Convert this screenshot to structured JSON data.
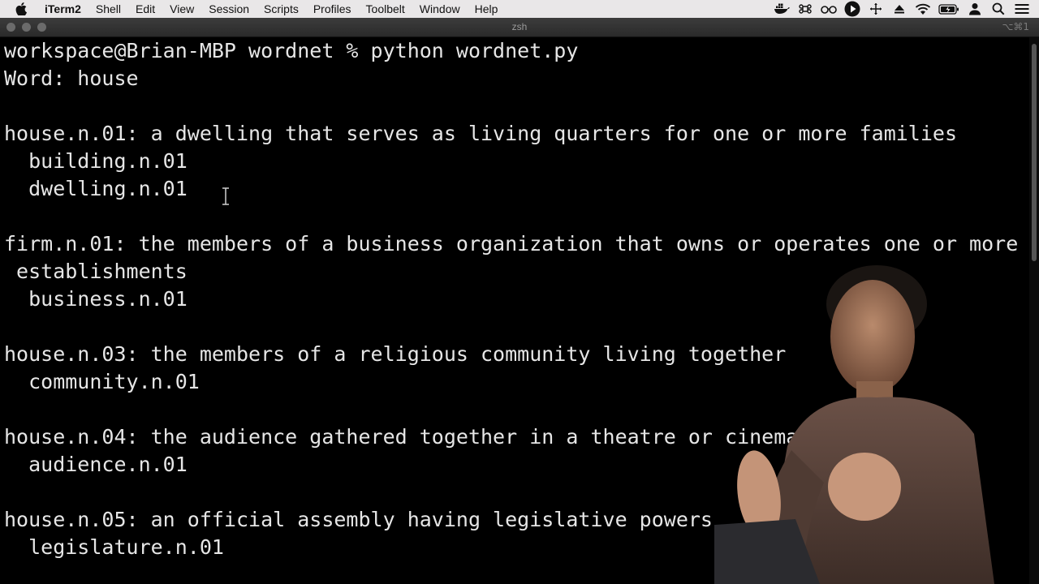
{
  "menubar": {
    "apple_icon": "apple-logo-icon",
    "app_name": "iTerm2",
    "items": [
      "Shell",
      "Edit",
      "View",
      "Session",
      "Scripts",
      "Profiles",
      "Toolbelt",
      "Window",
      "Help"
    ],
    "status_icons": [
      "docker-icon",
      "command-key-icon",
      "glasses-icon",
      "play-circle-icon",
      "move-icon",
      "eject-icon",
      "wifi-icon",
      "battery-icon",
      "user-icon",
      "search-icon",
      "control-center-icon"
    ]
  },
  "window": {
    "title": "zsh",
    "shortcut": "⌥⌘1"
  },
  "terminal": {
    "lines": [
      "workspace@Brian-MBP wordnet % python wordnet.py",
      "Word: house",
      "",
      "house.n.01: a dwelling that serves as living quarters for one or more families",
      "  building.n.01",
      "  dwelling.n.01",
      "",
      "firm.n.01: the members of a business organization that owns or operates one or more",
      " establishments",
      "  business.n.01",
      "",
      "house.n.03: the members of a religious community living together",
      "  community.n.01",
      "",
      "house.n.04: the audience gathered together in a theatre or cinema",
      "  audience.n.01",
      "",
      "house.n.05: an official assembly having legislative powers",
      "  legislature.n.01"
    ]
  },
  "colors": {
    "terminal_bg": "#000000",
    "terminal_fg": "#e6e6e6",
    "menubar_bg": "#e9e7e8"
  }
}
